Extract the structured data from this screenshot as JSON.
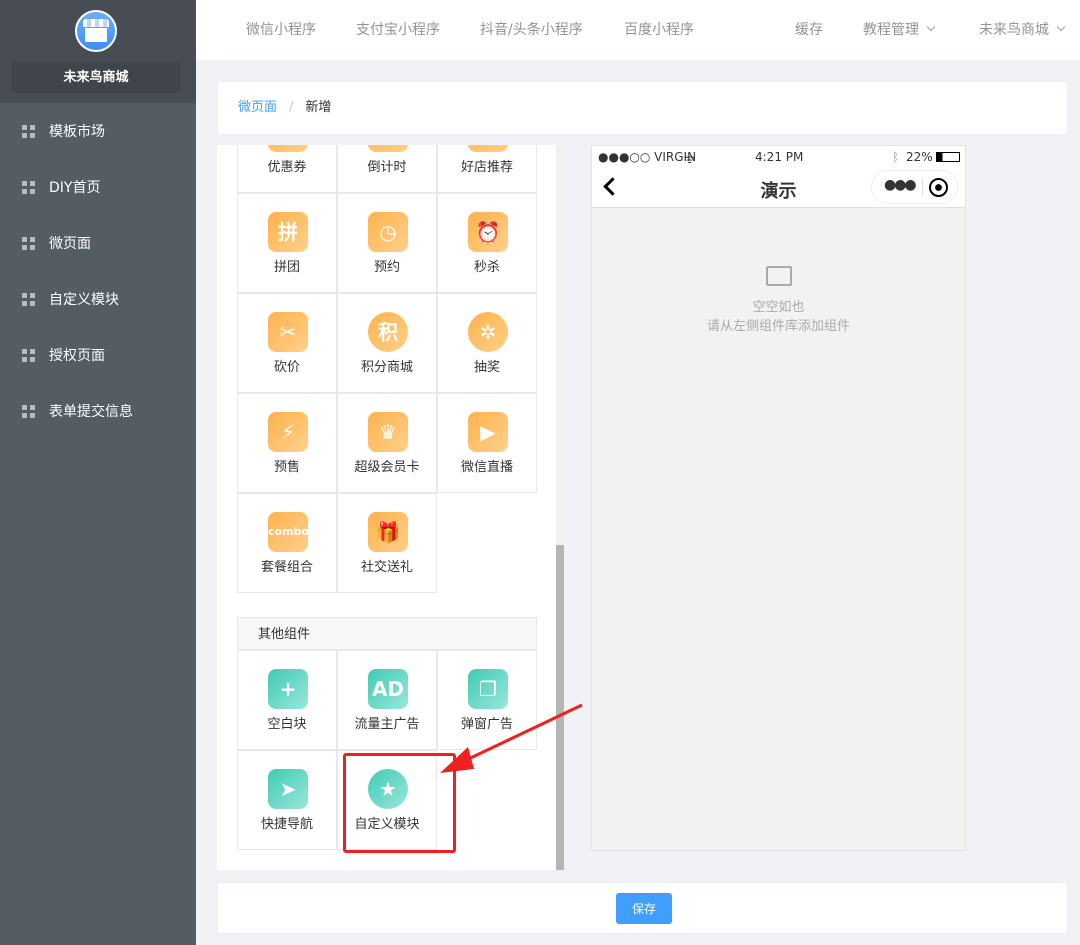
{
  "sidebar": {
    "shop_name": "未来鸟商城",
    "items": [
      {
        "label": "模板市场"
      },
      {
        "label": "DIY首页"
      },
      {
        "label": "微页面"
      },
      {
        "label": "自定义模块"
      },
      {
        "label": "授权页面"
      },
      {
        "label": "表单提交信息"
      }
    ]
  },
  "topnav": {
    "items": [
      "微信小程序",
      "支付宝小程序",
      "抖音/头条小程序",
      "百度小程序"
    ],
    "cache": "缓存",
    "tutorial": "教程管理",
    "shop": "未来鸟商城"
  },
  "breadcrumb": {
    "parent": "微页面",
    "current": "新增"
  },
  "components": {
    "marketing": [
      {
        "label": "优惠券",
        "icon": "coupon-icon"
      },
      {
        "label": "倒计时",
        "icon": "countdown-icon"
      },
      {
        "label": "好店推荐",
        "icon": "store-recommend-icon"
      },
      {
        "label": "拼团",
        "icon": "group-buy-icon",
        "glyph": "拼"
      },
      {
        "label": "预约",
        "icon": "calendar-clock-icon",
        "glyph": "◷"
      },
      {
        "label": "秒杀",
        "icon": "alarm-clock-icon",
        "glyph": "⏰"
      },
      {
        "label": "砍价",
        "icon": "bargain-tag-icon",
        "glyph": "✂"
      },
      {
        "label": "积分商城",
        "icon": "points-icon",
        "glyph": "积"
      },
      {
        "label": "抽奖",
        "icon": "lottery-wheel-icon",
        "glyph": "✲"
      },
      {
        "label": "预售",
        "icon": "presale-icon",
        "glyph": "⚡"
      },
      {
        "label": "超级会员卡",
        "icon": "crown-icon",
        "glyph": "♛"
      },
      {
        "label": "微信直播",
        "icon": "live-tv-icon",
        "glyph": "▶"
      },
      {
        "label": "套餐组合",
        "icon": "combo-icon",
        "glyph": "combo"
      },
      {
        "label": "社交送礼",
        "icon": "gift-icon",
        "glyph": "🎁"
      }
    ],
    "other_title": "其他组件",
    "other": [
      {
        "label": "空白块",
        "icon": "blank-block-icon",
        "glyph": "+"
      },
      {
        "label": "流量主广告",
        "icon": "ad-icon",
        "glyph": "AD"
      },
      {
        "label": "弹窗广告",
        "icon": "popup-ad-icon",
        "glyph": "❐"
      },
      {
        "label": "快捷导航",
        "icon": "paper-plane-icon",
        "glyph": "➤"
      },
      {
        "label": "自定义模块",
        "icon": "star-circle-icon",
        "glyph": "★"
      }
    ]
  },
  "phone": {
    "carrier": "●●●○○ VIRGIN",
    "time": "4:21 PM",
    "battery": "22%",
    "title": "演示",
    "empty_title": "空空如也",
    "empty_hint": "请从左侧组件库添加组件"
  },
  "footer": {
    "save_label": "保存"
  }
}
